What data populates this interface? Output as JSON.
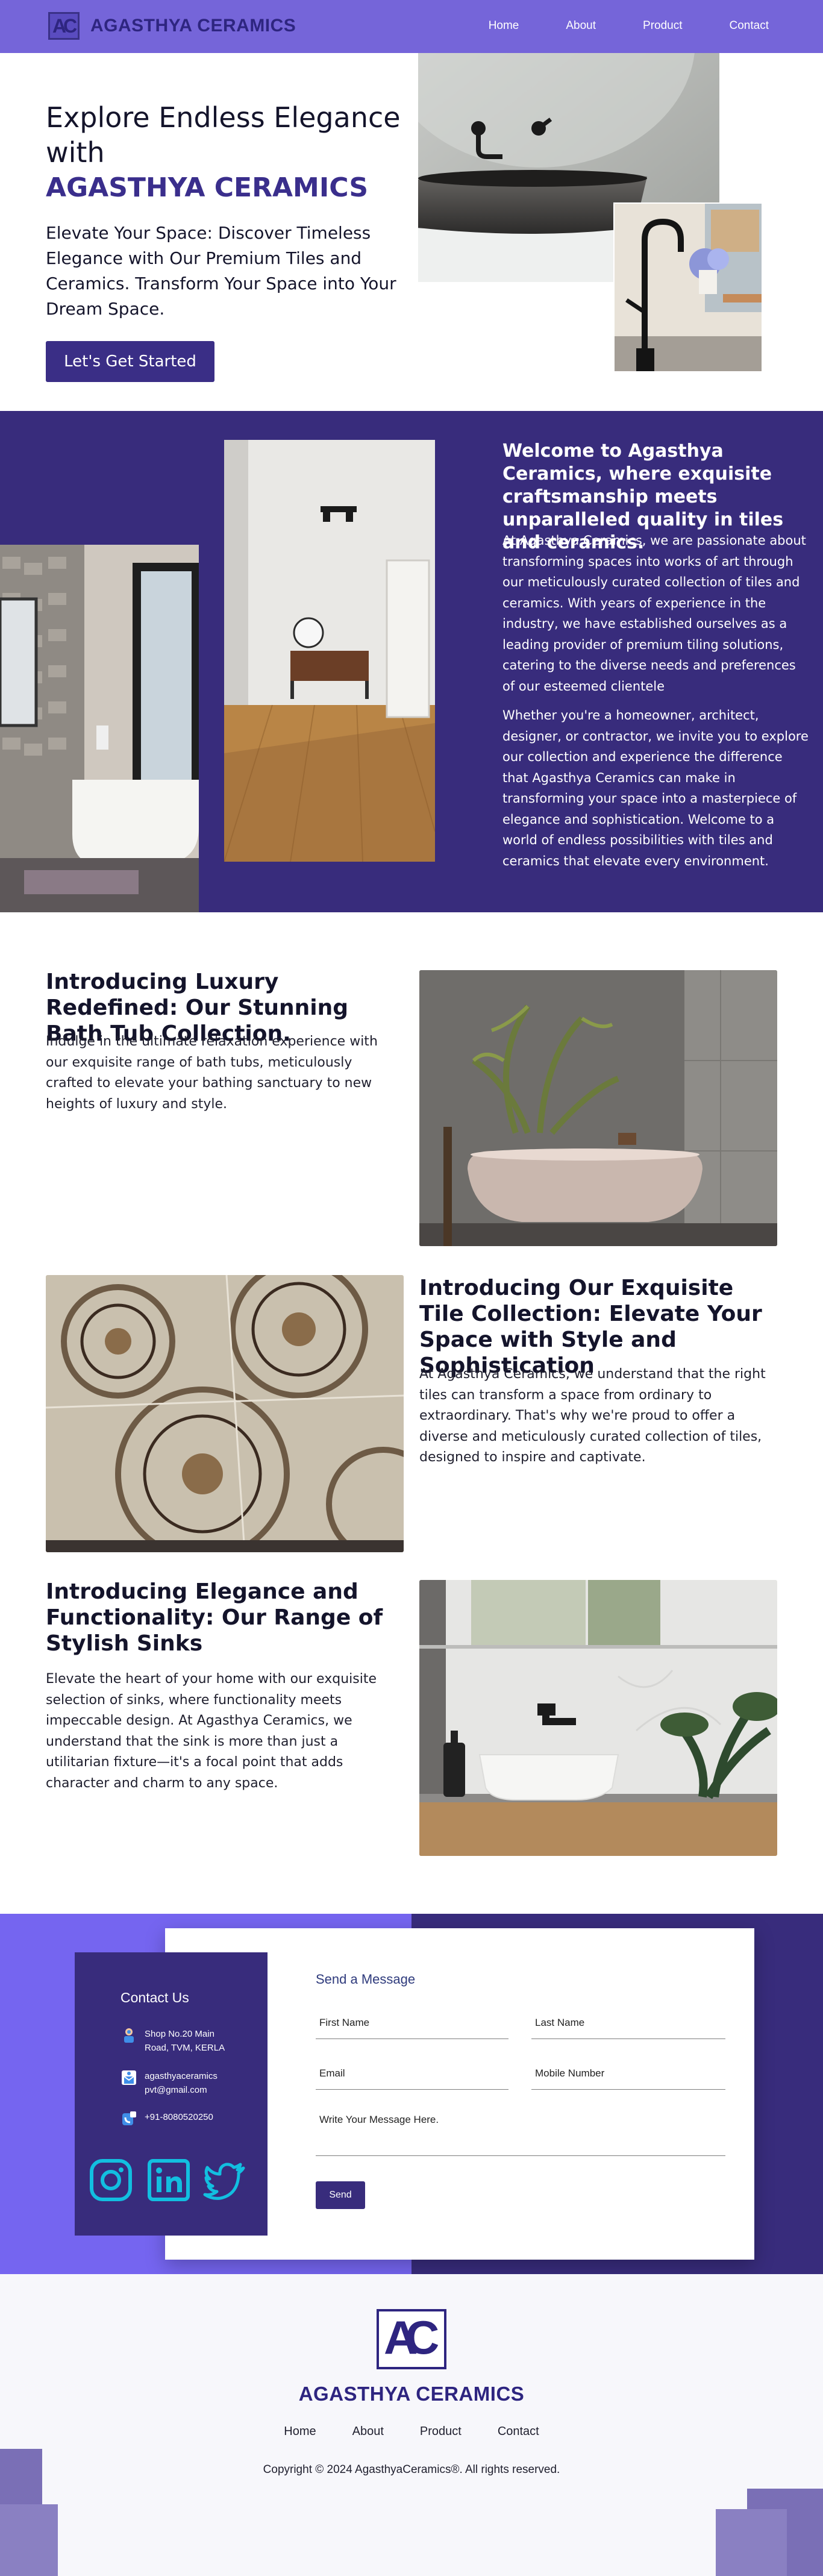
{
  "nav": {
    "logo_letters": {
      "a": "A",
      "c": "C"
    },
    "brand": "AGASTHYA CERAMICS",
    "links": [
      "Home",
      "About",
      "Product",
      "Contact"
    ]
  },
  "hero": {
    "title": "Explore Endless Elegance with",
    "brand": "AGASTHYA CERAMICS",
    "subtitle": "Elevate Your Space: Discover Timeless Elegance with Our Premium Tiles and Ceramics. Transform Your Space into Your Dream Space.",
    "cta": "Let's Get Started"
  },
  "welcome": {
    "title": "Welcome to Agasthya Ceramics, where exquisite craftsmanship meets unparalleled quality in tiles and ceramics.",
    "p1": " At Agasthya Ceramics, we are passionate about transforming spaces into works of art through our meticulously curated collection of tiles and ceramics. With years of experience in the industry, we have established ourselves as a leading provider of premium tiling solutions, catering to the diverse needs and preferences of our esteemed clientele",
    "p2": " Whether you're a homeowner, architect, designer, or contractor, we invite you to explore our collection and experience the difference that Agasthya Ceramics can make in transforming your space into a masterpiece of elegance and sophistication. Welcome to a world of endless possibilities with tiles and ceramics that elevate every environment."
  },
  "features": [
    {
      "title": "Introducing Luxury Redefined: Our Stunning Bath Tub Collection.",
      "text": "Indulge in the ultimate relaxation experience with our exquisite range of bath tubs, meticulously crafted to elevate your bathing sanctuary to new heights of luxury and style."
    },
    {
      "title": "Introducing Our Exquisite Tile Collection: Elevate Your Space with Style and Sophistication",
      "text": "At Agasthya Ceramics, we understand that the right tiles can transform a space from ordinary to extraordinary. That's why we're proud to offer a diverse and meticulously curated collection of tiles, designed to inspire and captivate."
    },
    {
      "title": "Introducing Elegance and Functionality: Our Range of Stylish Sinks",
      "text": "Elevate the heart of your home with our exquisite selection of sinks, where functionality meets impeccable design. At Agasthya Ceramics, we understand that the sink is more than just a utilitarian fixture—it's a focal point that adds character and charm to any space."
    }
  ],
  "contact": {
    "title": "Contact Us",
    "address": "Shop No.20 Main Road, TVM, KERLA",
    "email": "agasthyaceramics pvt@gmail.com",
    "phone": "+91-8080520250",
    "social_icons": [
      "instagram-icon",
      "linkedin-icon",
      "twitter-icon"
    ],
    "form": {
      "title": "Send a Message",
      "first_name_placeholder": "First Name",
      "last_name_placeholder": "Last Name",
      "email_placeholder": "Email",
      "mobile_placeholder": "Mobile Number",
      "message_placeholder": "Write Your Message Here.",
      "send": "Send"
    }
  },
  "footer": {
    "logo_letters": {
      "a": "A",
      "c": "C"
    },
    "brand": "AGASTHYA CERAMICS",
    "links": [
      "Home",
      "About",
      "Product",
      "Contact"
    ],
    "copyright": "Copyright © 2024 AgasthyaCeramics®. All rights reserved."
  },
  "colors": {
    "nav": "#7565d9",
    "primary": "#382c7c",
    "accent": "#7565f0",
    "brand_text": "#2e2580",
    "footer_bg": "#f7f7fb"
  }
}
